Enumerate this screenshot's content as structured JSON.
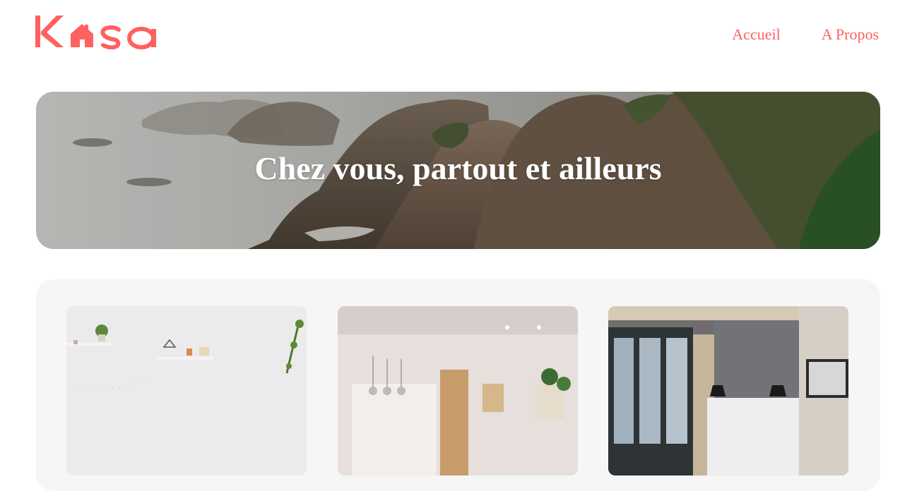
{
  "brand": {
    "logo_text": "Kasa",
    "accent_color": "#ff6060"
  },
  "nav": {
    "items": [
      {
        "label": "Accueil"
      },
      {
        "label": "A Propos"
      }
    ]
  },
  "hero": {
    "title": "Chez vous, partout et ailleurs"
  },
  "gallery": {
    "cards": [
      {
        "title": ""
      },
      {
        "title": ""
      },
      {
        "title": ""
      }
    ]
  }
}
